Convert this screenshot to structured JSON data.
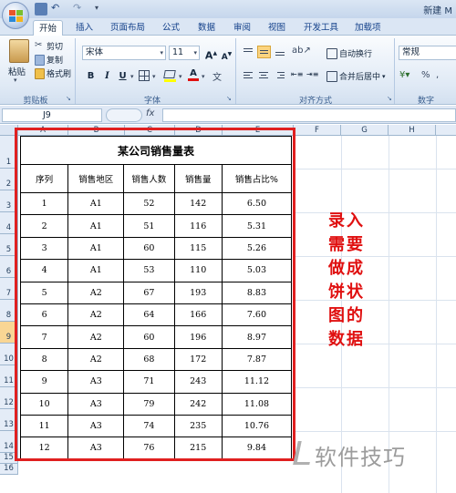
{
  "window": {
    "title": "新建 M"
  },
  "ribbon_tabs": [
    "开始",
    "插入",
    "页面布局",
    "公式",
    "数据",
    "审阅",
    "视图",
    "开发工具",
    "加载项"
  ],
  "clipboard": {
    "paste": "粘贴",
    "cut": "剪切",
    "copy": "复制",
    "format_painter": "格式刷",
    "group": "剪贴板"
  },
  "font": {
    "name": "宋体",
    "size": "11",
    "bold": "B",
    "italic": "I",
    "underline": "U",
    "group": "字体",
    "grow": "A",
    "shrink": "A"
  },
  "alignment": {
    "wrap_text": "自动换行",
    "merge_center": "合并后居中",
    "group": "对齐方式"
  },
  "number": {
    "format": "常规",
    "group": "数字"
  },
  "formula_bar": {
    "cell_ref": "J9",
    "fx": "fx",
    "content": ""
  },
  "columns": [
    "A",
    "B",
    "C",
    "D",
    "E",
    "F",
    "G",
    "H"
  ],
  "rows": [
    "1",
    "2",
    "3",
    "4",
    "5",
    "6",
    "7",
    "8",
    "9",
    "10",
    "11",
    "12",
    "13",
    "14",
    "15",
    "16"
  ],
  "table": {
    "title": "某公司销售量表",
    "headers": [
      "序列",
      "销售地区",
      "销售人数",
      "销售量",
      "销售占比%"
    ],
    "rows": [
      [
        "1",
        "A1",
        "52",
        "142",
        "6.50"
      ],
      [
        "2",
        "A1",
        "51",
        "116",
        "5.31"
      ],
      [
        "3",
        "A1",
        "60",
        "115",
        "5.26"
      ],
      [
        "4",
        "A1",
        "53",
        "110",
        "5.03"
      ],
      [
        "5",
        "A2",
        "67",
        "193",
        "8.83"
      ],
      [
        "6",
        "A2",
        "64",
        "166",
        "7.60"
      ],
      [
        "7",
        "A2",
        "60",
        "196",
        "8.97"
      ],
      [
        "8",
        "A2",
        "68",
        "172",
        "7.87"
      ],
      [
        "9",
        "A3",
        "71",
        "243",
        "11.12"
      ],
      [
        "10",
        "A3",
        "79",
        "242",
        "11.08"
      ],
      [
        "11",
        "A3",
        "74",
        "235",
        "10.76"
      ],
      [
        "12",
        "A3",
        "76",
        "215",
        "9.84"
      ]
    ]
  },
  "annotation": "录入需要做成饼状图的数据",
  "watermark": "软件技巧",
  "colors": {
    "highlight_border": "#e02020",
    "annotation_text": "#e01010",
    "ribbon_bg": "#dfe9f5"
  }
}
